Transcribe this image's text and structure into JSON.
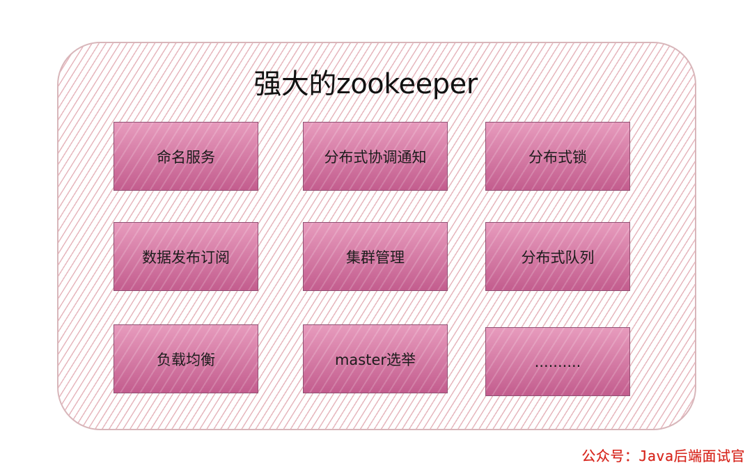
{
  "title": "强大的zookeeper",
  "features": [
    "命名服务",
    "分布式协调通知",
    "分布式锁",
    "数据发布订阅",
    "集群管理",
    "分布式队列",
    "负载均衡",
    "master选举",
    ".........."
  ],
  "watermark": "公众号：Java后端面试官",
  "colors": {
    "box_fill": "#c35d8e",
    "box_border": "#8f5073",
    "panel_hatch": "#e2aab2",
    "watermark": "#d7261d"
  }
}
